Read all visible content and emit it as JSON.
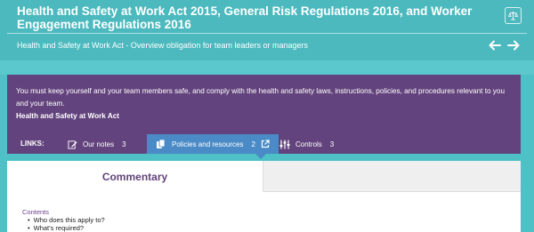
{
  "header": {
    "title": "Health and Safety at Work Act 2015, General Risk Regulations 2016, and Worker Engagement Regulations 2016",
    "subtitle": "Health and Safety at Work Act - Overview obligation for team leaders or managers",
    "scales_icon": "scales-icon",
    "prev_icon": "arrow-left-icon",
    "next_icon": "arrow-right-icon"
  },
  "panel": {
    "text": "You must keep yourself and your team members safe, and comply with the health and safety laws, instructions, policies, and procedures relevant to you and your team.",
    "act": "Health and Safety at Work Act"
  },
  "links": {
    "label": "LINKS:",
    "items": [
      {
        "label": "Our notes",
        "count": "3",
        "icon": "edit-icon"
      },
      {
        "label": "Policies and resources",
        "count": "2",
        "icon": "documents-icon",
        "extra_icon": "external-link-icon"
      },
      {
        "label": "Controls",
        "count": "3",
        "icon": "sliders-icon"
      }
    ]
  },
  "tabs": {
    "active_label": "Commentary"
  },
  "contents": {
    "title": "Contents",
    "items": [
      "Who does this apply to?",
      "What's required?"
    ]
  },
  "colors": {
    "teal_header": "#4bb9be",
    "teal_bg": "#4ec1c6",
    "purple": "#63437d",
    "blue_active": "#4a8ac6"
  }
}
